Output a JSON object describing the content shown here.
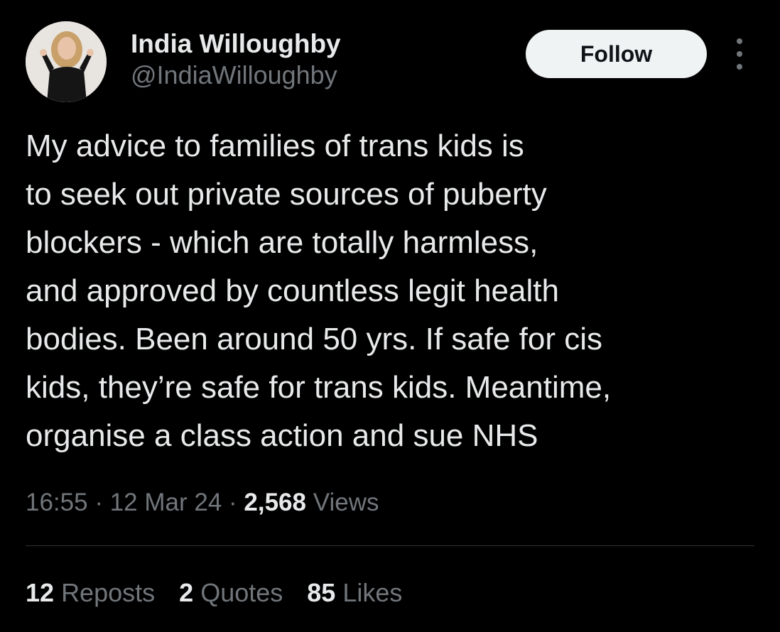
{
  "author": {
    "display_name": "India Willoughby",
    "handle": "@IndiaWilloughby"
  },
  "follow_button": {
    "label": "Follow"
  },
  "more_icon": "more-vertical-dots-icon",
  "tweet": {
    "text_lines": [
      "My advice to families of trans kids is",
      "to seek out private sources of puberty",
      "blockers - which are totally harmless,",
      "and approved by countless legit health",
      "bodies. Been around 50 yrs. If safe for cis",
      "kids, they’re safe for trans kids. Meantime,",
      "organise a class action and sue NHS"
    ],
    "time": "16:55",
    "date": "12 Mar 24",
    "separator": " · ",
    "views_count": "2,568",
    "views_label": "Views"
  },
  "stats": {
    "reposts_count": "12",
    "reposts_label": "Reposts",
    "quotes_count": "2",
    "quotes_label": "Quotes",
    "likes_count": "85",
    "likes_label": "Likes"
  },
  "colors": {
    "background": "#000000",
    "primary_text": "#e7e9ea",
    "secondary_text": "#71767b",
    "follow_button_bg": "#eff3f4",
    "divider": "#2f3336"
  }
}
